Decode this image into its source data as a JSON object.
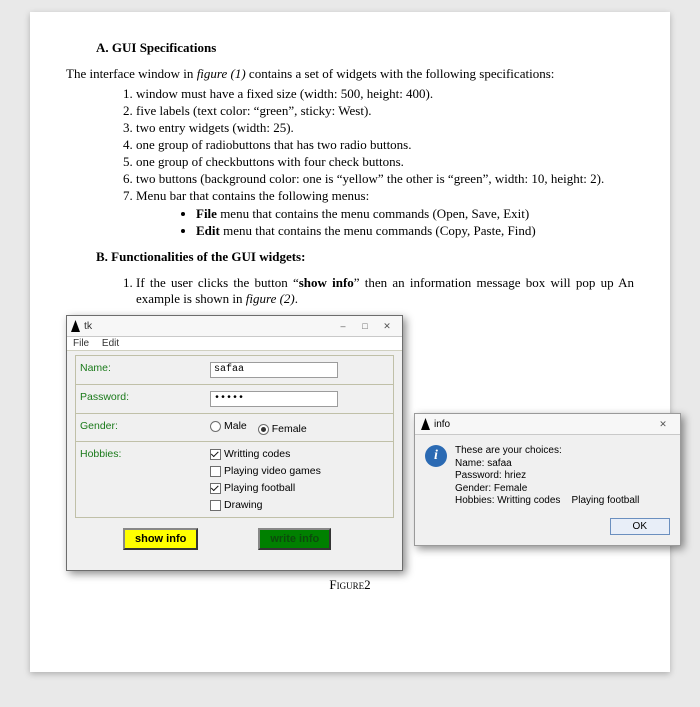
{
  "sectionA": {
    "heading": "A. GUI Specifications",
    "intro_pre": "The interface window in ",
    "intro_fig": "figure (1)",
    "intro_post": " contains a set of widgets with the following specifications:",
    "items": [
      "window must have a fixed size (width: 500, height: 400).",
      "five labels (text color: “green”, sticky: West).",
      "two entry widgets (width: 25).",
      "one group of radiobuttons that has two radio buttons.",
      "one group of checkbuttons with four check buttons.",
      "two buttons (background color: one is “yellow” the other is “green”, width: 10, height: 2).",
      "Menu bar that contains the following menus:"
    ],
    "bullets": [
      {
        "bold": "File",
        "rest": " menu that contains the menu commands (Open, Save, Exit)"
      },
      {
        "bold": "Edit",
        "rest": " menu that contains the menu commands (Copy, Paste, Find)"
      }
    ]
  },
  "sectionB": {
    "heading": "B. Functionalities of the GUI widgets:",
    "item_pre": "If the user clicks the button “",
    "item_bold": "show info",
    "item_mid": "” then an information message box will pop up An example is shown in ",
    "item_fig": "figure (2)",
    "item_end": "."
  },
  "tk": {
    "title": "tk",
    "min": "—",
    "max": "☐",
    "close": "✕",
    "menu": {
      "file": "File",
      "edit": "Edit"
    },
    "labels": {
      "name": "Name:",
      "password": "Password:",
      "gender": "Gender:",
      "hobbies": "Hobbies:"
    },
    "entries": {
      "name": "safaa",
      "password": "•••••"
    },
    "gender": {
      "male": "Male",
      "female": "Female"
    },
    "hobbies": {
      "h1": "Writting codes",
      "h2": "Playing video games",
      "h3": "Playing football",
      "h4": "Drawing"
    },
    "buttons": {
      "show": "show info",
      "write": "write info"
    }
  },
  "info": {
    "title": "info",
    "close": "✕",
    "l1": "These are your choices:",
    "l2": "Name: safaa",
    "l3": "Password: hriez",
    "l4": "Gender: Female",
    "l5a": "Hobbies: Writting codes",
    "l5b": "Playing football",
    "ok": "OK"
  },
  "figcaption": "Figure2"
}
